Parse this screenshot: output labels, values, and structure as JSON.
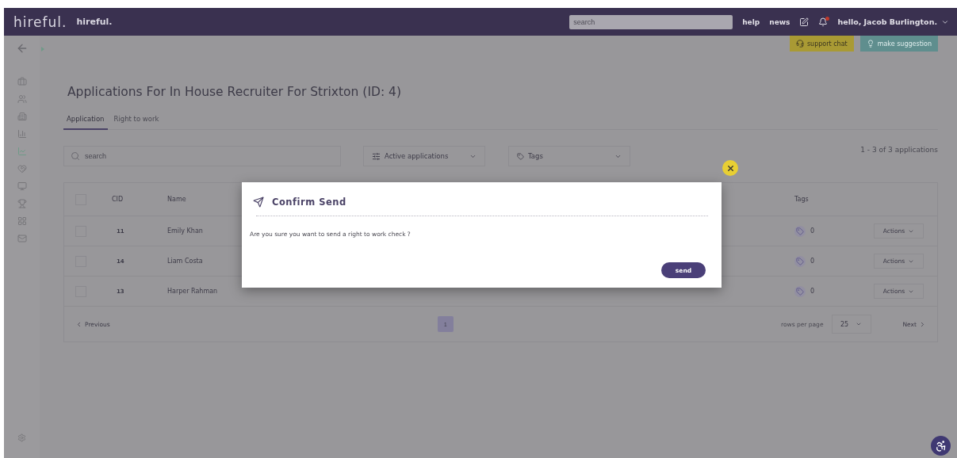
{
  "header": {
    "logo": "hireful.",
    "brand": "hireful.",
    "search": {
      "placeholder": "search"
    },
    "links": [
      "help",
      "news"
    ],
    "notifications": {
      "unread": true
    },
    "user": "hello, Jacob Burlington."
  },
  "sidebar": {
    "items": [
      {
        "kind": "briefcase",
        "selected": false
      },
      {
        "kind": "people",
        "selected": false
      },
      {
        "kind": "building",
        "selected": false
      },
      {
        "kind": "chart",
        "selected": false
      },
      {
        "kind": "report",
        "selected": true
      },
      {
        "kind": "handshake",
        "selected": false
      },
      {
        "kind": "monitor",
        "selected": false
      },
      {
        "kind": "trophy",
        "selected": false
      },
      {
        "kind": "grid",
        "selected": false
      },
      {
        "kind": "mail",
        "selected": false
      }
    ]
  },
  "help_buttons": [
    {
      "kind": "support",
      "label": "support chat"
    },
    {
      "kind": "suggestion",
      "label": "make suggestion"
    }
  ],
  "title": "Applications For In House Recruiter For Strixton (ID: 4)",
  "tabs": [
    {
      "label": "Application",
      "selected": true
    },
    {
      "label": "Right to work",
      "selected": false
    }
  ],
  "filters": {
    "search": {
      "placeholder": "search"
    },
    "status": "Active applications",
    "tags": "Tags"
  },
  "count": "1 - 3 of 3 applications",
  "table": {
    "select_all": {
      "checked": false
    },
    "columns": [
      "CID",
      "Name",
      "Tags"
    ],
    "rows": [
      {
        "checked": false,
        "cid": "11",
        "name": "Emily Khan",
        "tags": "0",
        "action": "Actions"
      },
      {
        "checked": false,
        "cid": "14",
        "name": "Liam Costa",
        "tags": "0",
        "action": "Actions"
      },
      {
        "checked": false,
        "cid": "13",
        "name": "Harper Rahman",
        "tags": "0",
        "action": "Actions"
      }
    ]
  },
  "pagination": {
    "previous": "Previous",
    "pages": [
      {
        "label": "1",
        "selected": true
      }
    ],
    "rows_per_page_label": "rows per page",
    "rows_per_page": "25",
    "next": "Next"
  },
  "modal": {
    "title": "Confirm Send",
    "message": "Are you sure you want to send a right to work check ?",
    "button": "send"
  }
}
